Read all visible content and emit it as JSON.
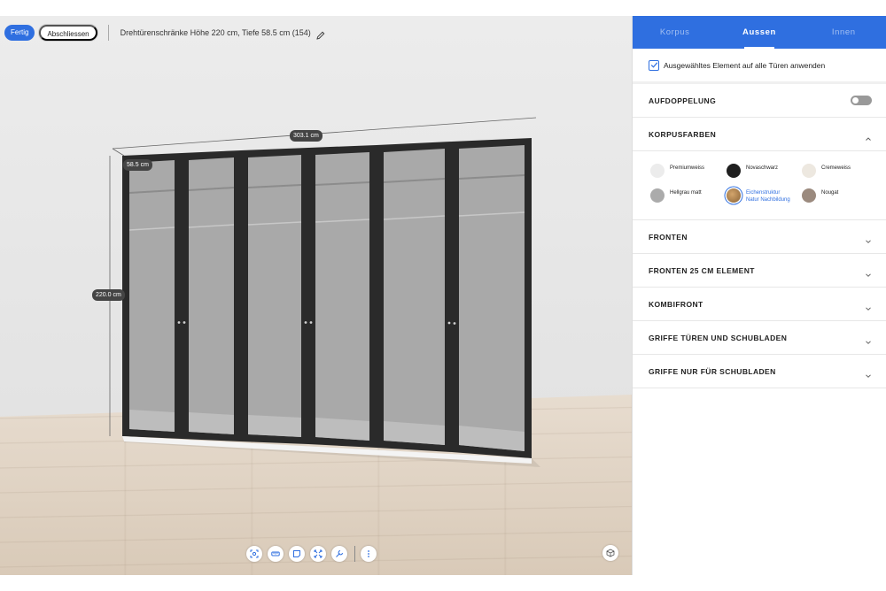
{
  "header": {
    "done_label": "Fertig",
    "close_label": "Abschliessen",
    "title": "Drehtürenschränke Höhe 220 cm, Tiefe 58.5 cm (154)"
  },
  "dimensions": {
    "width": "303.1 cm",
    "depth": "58.5 cm",
    "height": "220.0 cm"
  },
  "viewer_tools": [
    {
      "name": "screenshot-icon"
    },
    {
      "name": "measure-icon"
    },
    {
      "name": "note-icon"
    },
    {
      "name": "fullscreen-icon"
    },
    {
      "name": "tools-icon"
    },
    {
      "name": "more-icon"
    }
  ],
  "tabs": [
    {
      "label": "Korpus",
      "active": false
    },
    {
      "label": "Aussen",
      "active": true
    },
    {
      "label": "Innen",
      "active": false
    }
  ],
  "apply_all": {
    "label": "Ausgewähltes Element auf alle Türen anwenden",
    "checked": true
  },
  "sections": {
    "aufdoppelung": "AUFDOPPELUNG",
    "korpusfarben": "KORPUSFARBEN",
    "fronten": "FRONTEN",
    "fronten25": "FRONTEN 25 CM ELEMENT",
    "kombifront": "KOMBIFRONT",
    "griffe_tueren": "GRIFFE TÜREN UND SCHUBLADEN",
    "griffe_schubladen": "GRIFFE NUR FÜR SCHUBLADEN"
  },
  "colors": [
    {
      "label": "Premiumweiss",
      "color": "#ececec"
    },
    {
      "label": "Novaschwarz",
      "color": "#1f1f1f"
    },
    {
      "label": "Cremeweiss",
      "color": "#ede8e0"
    },
    {
      "label": "Hellgrau matt",
      "color": "#ababab"
    },
    {
      "label": "Eichenstruktur",
      "label2": "Natur Nachbildung",
      "color": "#b88a55",
      "selected": true
    },
    {
      "label": "Nougat",
      "color": "#9b8a7e"
    }
  ],
  "theme": {
    "accent": "#2f6fe0"
  }
}
